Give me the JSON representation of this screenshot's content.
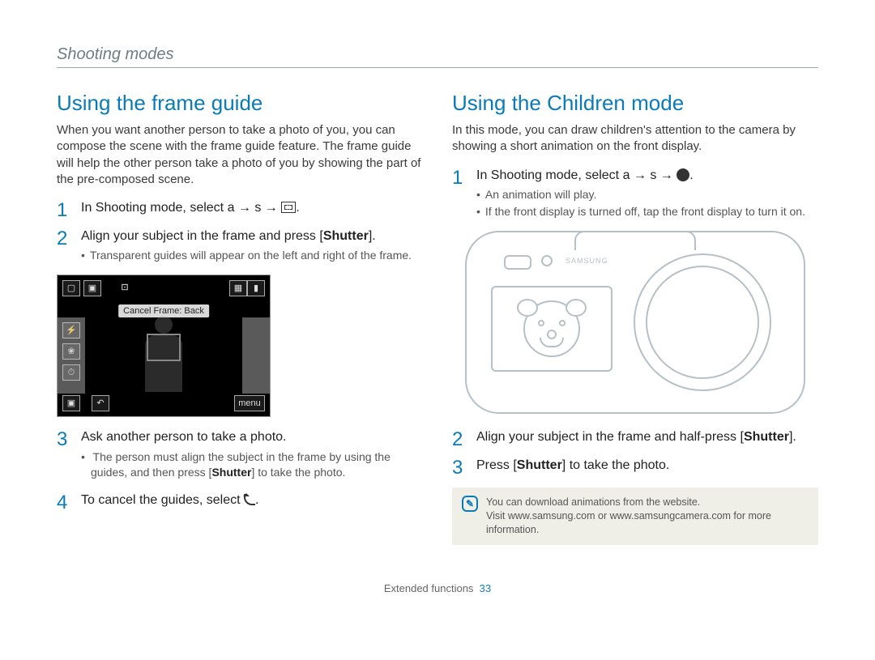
{
  "header": {
    "section_title": "Shooting modes"
  },
  "left": {
    "heading": "Using the frame guide",
    "intro": "When you want another person to take a photo of you, you can compose the scene with the frame guide feature. The frame guide will help the other person take a photo of you by showing the part of the pre-composed scene.",
    "steps": [
      {
        "num": "1",
        "title_prefix": "In Shooting mode, select ",
        "title_mid_a": "a",
        "title_arrow": " → ",
        "title_s": "s",
        "title_end": "."
      },
      {
        "num": "2",
        "title_prefix": "Align your subject in the frame and press [",
        "title_bold": "Shutter",
        "title_suffix": "].",
        "bullets": [
          "Transparent guides will appear on the left and right of the frame."
        ]
      },
      {
        "num": "3",
        "title": "Ask another person to take a photo.",
        "bullets_rich": {
          "pre": "The person must align the subject in the frame by using the guides, and then press [",
          "bold": "Shutter",
          "post": "] to take the photo."
        }
      },
      {
        "num": "4",
        "title_prefix": "To cancel the guides, select ",
        "title_suffix": "."
      }
    ],
    "lcd": {
      "caption": "Cancel Frame: Back",
      "menu_label": "menu"
    }
  },
  "right": {
    "heading": "Using the Children mode",
    "intro": "In this mode, you can draw children's attention to the camera by showing a short animation on the front display.",
    "steps": [
      {
        "num": "1",
        "title_prefix": "In Shooting mode, select ",
        "title_mid_a": "a",
        "title_arrow": " → ",
        "title_s": "s",
        "title_end": ".",
        "bullets": [
          "An animation will play.",
          "If the front display is turned off, tap the front display to turn it on."
        ]
      },
      {
        "num": "2",
        "title_prefix": "Align your subject in the frame and half-press [",
        "title_bold": "Shutter",
        "title_suffix": "]."
      },
      {
        "num": "3",
        "title_prefix": "Press [",
        "title_bold": "Shutter",
        "title_suffix": "] to take the photo."
      }
    ],
    "note": {
      "line1": "You can download animations from the website.",
      "line2": "Visit www.samsung.com or www.samsungcamera.com for more information."
    },
    "camera_logo": "SAMSUNG"
  },
  "footer": {
    "section": "Extended functions",
    "page": "33"
  }
}
